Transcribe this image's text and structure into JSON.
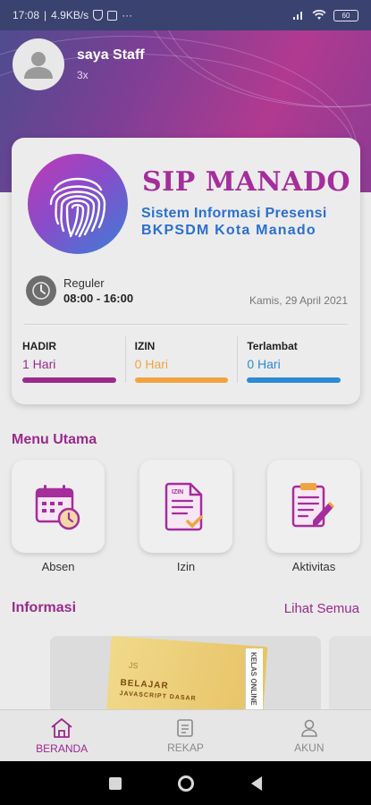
{
  "status_bar": {
    "time": "17:08",
    "speed": "4.9KB/s",
    "dots": "···",
    "battery": "60"
  },
  "profile": {
    "name": "saya Staff",
    "subtitle": "3x"
  },
  "app": {
    "title": "SIP MANADO",
    "subtitle1": "Sistem Informasi Presensi",
    "subtitle2": "BKPSDM Kota Manado"
  },
  "schedule": {
    "shift": "Reguler",
    "time": "08:00 - 16:00",
    "date": "Kamis, 29 April 2021"
  },
  "stats": [
    {
      "label": "HADIR",
      "value": "1 Hari",
      "color": "#9a2a8c"
    },
    {
      "label": "IZIN",
      "value": "0 Hari",
      "color": "#f0a441"
    },
    {
      "label": "Terlambat",
      "value": "0 Hari",
      "color": "#2d8ad6"
    }
  ],
  "menu": {
    "title": "Menu Utama",
    "items": [
      {
        "label": "Absen",
        "icon": "calendar-clock-icon"
      },
      {
        "label": "Izin",
        "icon": "document-check-icon"
      },
      {
        "label": "Aktivitas",
        "icon": "clipboard-edit-icon"
      }
    ]
  },
  "info": {
    "title": "Informasi",
    "see_all": "Lihat Semua",
    "banner_text": "BELAJAR",
    "banner_sub": "JAVASCRIPT DASAR",
    "banner_side": "KELAS ONLINE",
    "banner_logo": "JS"
  },
  "bottom_nav": [
    {
      "label": "BERANDA",
      "icon": "home-icon",
      "active": true
    },
    {
      "label": "REKAP",
      "icon": "report-icon",
      "active": false
    },
    {
      "label": "AKUN",
      "icon": "user-icon",
      "active": false
    }
  ],
  "colors": {
    "accent": "#9a2a8c",
    "title": "#a62d9c",
    "blue": "#2c6fd0"
  }
}
